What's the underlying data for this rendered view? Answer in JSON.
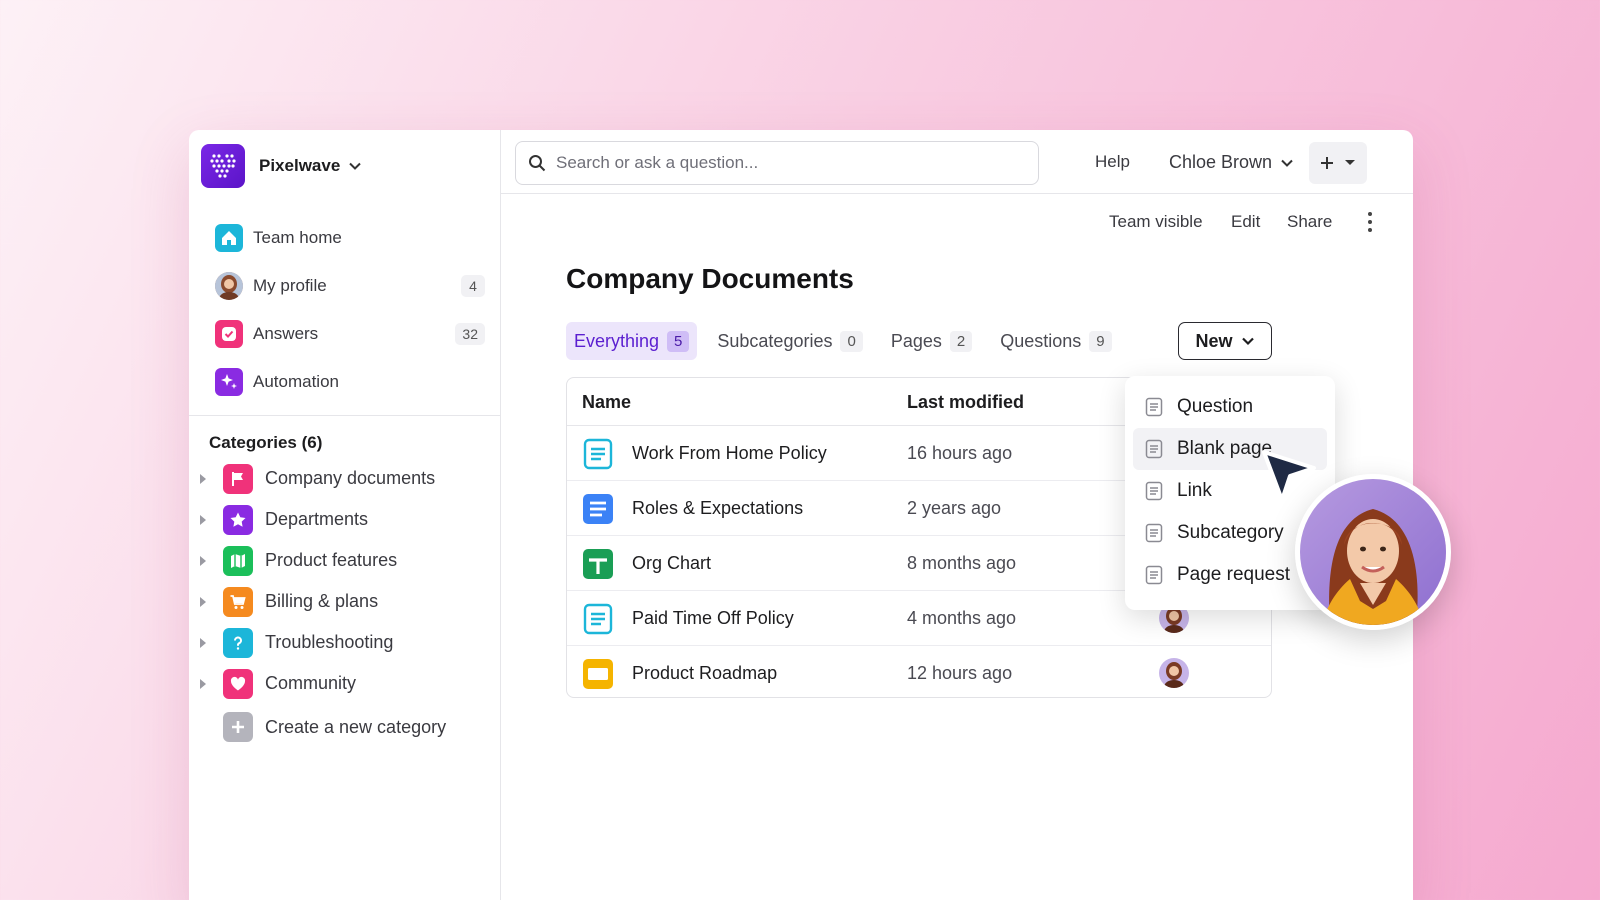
{
  "brand": {
    "name": "Pixelwave"
  },
  "nav": [
    {
      "label": "Team home",
      "icon": "home-icon",
      "color": "#1cb6d9"
    },
    {
      "label": "My profile",
      "icon": "avatar",
      "count": "4"
    },
    {
      "label": "Answers",
      "icon": "answers-icon",
      "count": "32",
      "color": "#f0327a"
    },
    {
      "label": "Automation",
      "icon": "sparkle-icon",
      "color": "#8a2be2"
    }
  ],
  "categories": {
    "title": "Categories (6)",
    "items": [
      {
        "label": "Company documents",
        "icon": "flag-icon",
        "color": "#f0327a"
      },
      {
        "label": "Departments",
        "icon": "star-icon",
        "color": "#8a2be2"
      },
      {
        "label": "Product features",
        "icon": "map-icon",
        "color": "#1bbf5a"
      },
      {
        "label": "Billing & plans",
        "icon": "cart-icon",
        "color": "#f58a1f"
      },
      {
        "label": "Troubleshooting",
        "icon": "question-icon",
        "color": "#1cb6d9"
      },
      {
        "label": "Community",
        "icon": "heart-icon",
        "color": "#f0327a"
      }
    ],
    "create_label": "Create a new category"
  },
  "topbar": {
    "search_placeholder": "Search or ask a question...",
    "help": "Help",
    "user": "Chloe Brown"
  },
  "page_actions": {
    "visibility": "Team visible",
    "edit": "Edit",
    "share": "Share"
  },
  "page": {
    "title": "Company Documents",
    "tabs": [
      {
        "label": "Everything",
        "count": "5",
        "active": true
      },
      {
        "label": "Subcategories",
        "count": "0"
      },
      {
        "label": "Pages",
        "count": "2"
      },
      {
        "label": "Questions",
        "count": "9"
      }
    ],
    "new_button": "New"
  },
  "table": {
    "headers": {
      "name": "Name",
      "modified": "Last modified"
    },
    "rows": [
      {
        "name": "Work From Home Policy",
        "modified": "16 hours ago",
        "icon": "google-doc-icon"
      },
      {
        "name": "Roles & Expectations",
        "modified": "2 years ago",
        "icon": "doc-icon"
      },
      {
        "name": "Org Chart",
        "modified": "8 months ago",
        "icon": "sheets-icon"
      },
      {
        "name": "Paid Time Off Policy",
        "modified": "4 months ago",
        "icon": "google-doc-icon"
      },
      {
        "name": "Product Roadmap",
        "modified": "12 hours ago",
        "icon": "slides-icon"
      }
    ]
  },
  "new_menu": [
    "Question",
    "Blank page",
    "Link",
    "Subcategory",
    "Page request"
  ]
}
